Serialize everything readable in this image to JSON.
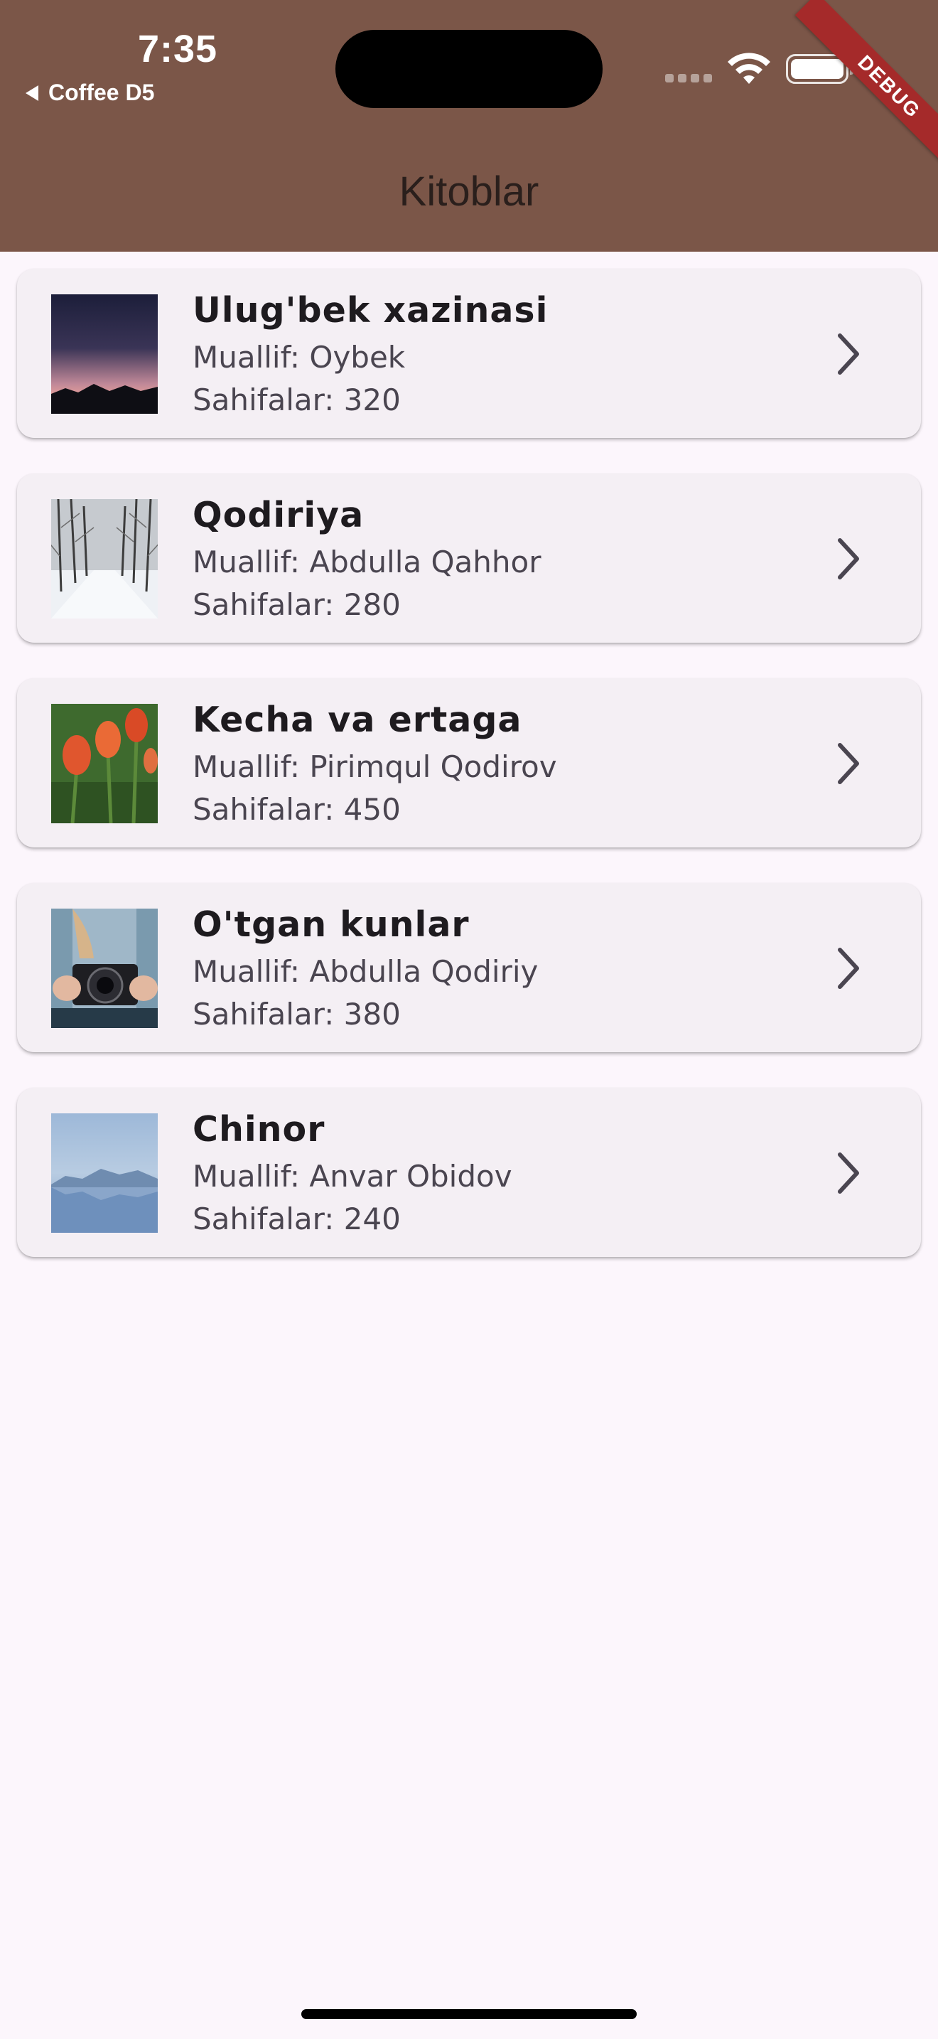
{
  "status_bar": {
    "time": "7:35",
    "back_app": "Coffee D5",
    "icons": [
      "signal-icon",
      "wifi-icon",
      "battery-icon"
    ]
  },
  "debug_banner": "DEBUG",
  "app_bar": {
    "title": "Kitoblar",
    "background": "#7B5648"
  },
  "books": [
    {
      "title": "Ulug'bek xazinasi",
      "author": "Muallif: Oybek",
      "pages": "Sahifalar: 320",
      "thumbnail": "dusk-mountains-image"
    },
    {
      "title": "Qodiriya",
      "author": "Muallif: Abdulla Qahhor",
      "pages": "Sahifalar: 280",
      "thumbnail": "snowy-road-image"
    },
    {
      "title": "Kecha va ertaga",
      "author": "Muallif: Pirimqul Qodirov",
      "pages": "Sahifalar: 450",
      "thumbnail": "tulips-image"
    },
    {
      "title": "O'tgan kunlar",
      "author": "Muallif: Abdulla Qodiriy",
      "pages": "Sahifalar: 380",
      "thumbnail": "camera-hands-image"
    },
    {
      "title": "Chinor",
      "author": "Muallif: Anvar Obidov",
      "pages": "Sahifalar: 240",
      "thumbnail": "lake-mountains-image"
    }
  ],
  "colors": {
    "page_background": "#FCF6FC",
    "card_background": "#F4EFF4",
    "title_text": "#1E1B1F",
    "secondary_text": "#4A4550",
    "debug_banner": "#A52A2A"
  }
}
